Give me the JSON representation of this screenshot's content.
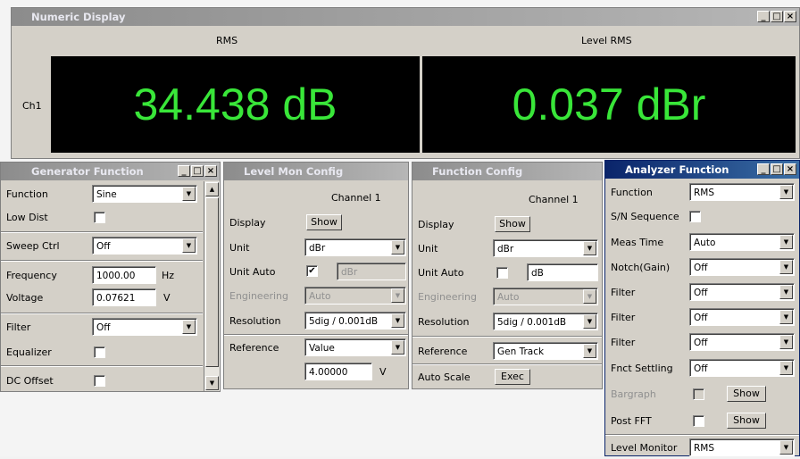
{
  "numeric": {
    "title": "Numeric Display",
    "col1": "RMS",
    "col2": "Level RMS",
    "row": "Ch1",
    "value1": "34.438 dB",
    "value2": "0.037 dBr"
  },
  "generator": {
    "title": "Generator Function",
    "function_label": "Function",
    "function_value": "Sine",
    "lowdist_label": "Low Dist",
    "sweep_label": "Sweep Ctrl",
    "sweep_value": "Off",
    "freq_label": "Frequency",
    "freq_value": "1000.00",
    "freq_unit": "Hz",
    "volt_label": "Voltage",
    "volt_value": "0.07621",
    "volt_unit": "V",
    "filter_label": "Filter",
    "filter_value": "Off",
    "eq_label": "Equalizer",
    "dc_label": "DC Offset"
  },
  "levelmon": {
    "title": "Level Mon Config",
    "channel": "Channel 1",
    "display_label": "Display",
    "display_btn": "Show",
    "unit_label": "Unit",
    "unit_value": "dBr",
    "unitauto_label": "Unit Auto",
    "unitauto_check": "✔",
    "unitauto_value": "dBr",
    "eng_label": "Engineering",
    "eng_value": "Auto",
    "res_label": "Resolution",
    "res_value": "5dig / 0.001dB",
    "ref_label": "Reference",
    "ref_value": "Value",
    "ref_num": "4.00000",
    "ref_unit": "V"
  },
  "funcconfig": {
    "title": "Function Config",
    "channel": "Channel 1",
    "display_label": "Display",
    "display_btn": "Show",
    "unit_label": "Unit",
    "unit_value": "dBr",
    "unitauto_label": "Unit Auto",
    "unitauto_value": "dB",
    "eng_label": "Engineering",
    "eng_value": "Auto",
    "res_label": "Resolution",
    "res_value": "5dig / 0.001dB",
    "ref_label": "Reference",
    "ref_value": "Gen Track",
    "autoscale_label": "Auto Scale",
    "autoscale_btn": "Exec"
  },
  "analyzer": {
    "title": "Analyzer Function",
    "function_label": "Function",
    "function_value": "RMS",
    "sn_label": "S/N Sequence",
    "meas_label": "Meas Time",
    "meas_value": "Auto",
    "notch_label": "Notch(Gain)",
    "notch_value": "Off",
    "filter1_label": "Filter",
    "filter1_value": "Off",
    "filter2_label": "Filter",
    "filter2_value": "Off",
    "filter3_label": "Filter",
    "filter3_value": "Off",
    "fnct_label": "Fnct Settling",
    "fnct_value": "Off",
    "bargraph_label": "Bargraph",
    "bargraph_btn": "Show",
    "postfft_label": "Post FFT",
    "postfft_btn": "Show",
    "levmon_label": "Level Monitor",
    "levmon_value": "RMS"
  },
  "titlebar_buttons": {
    "min": "_",
    "max": "□",
    "close": "×"
  }
}
